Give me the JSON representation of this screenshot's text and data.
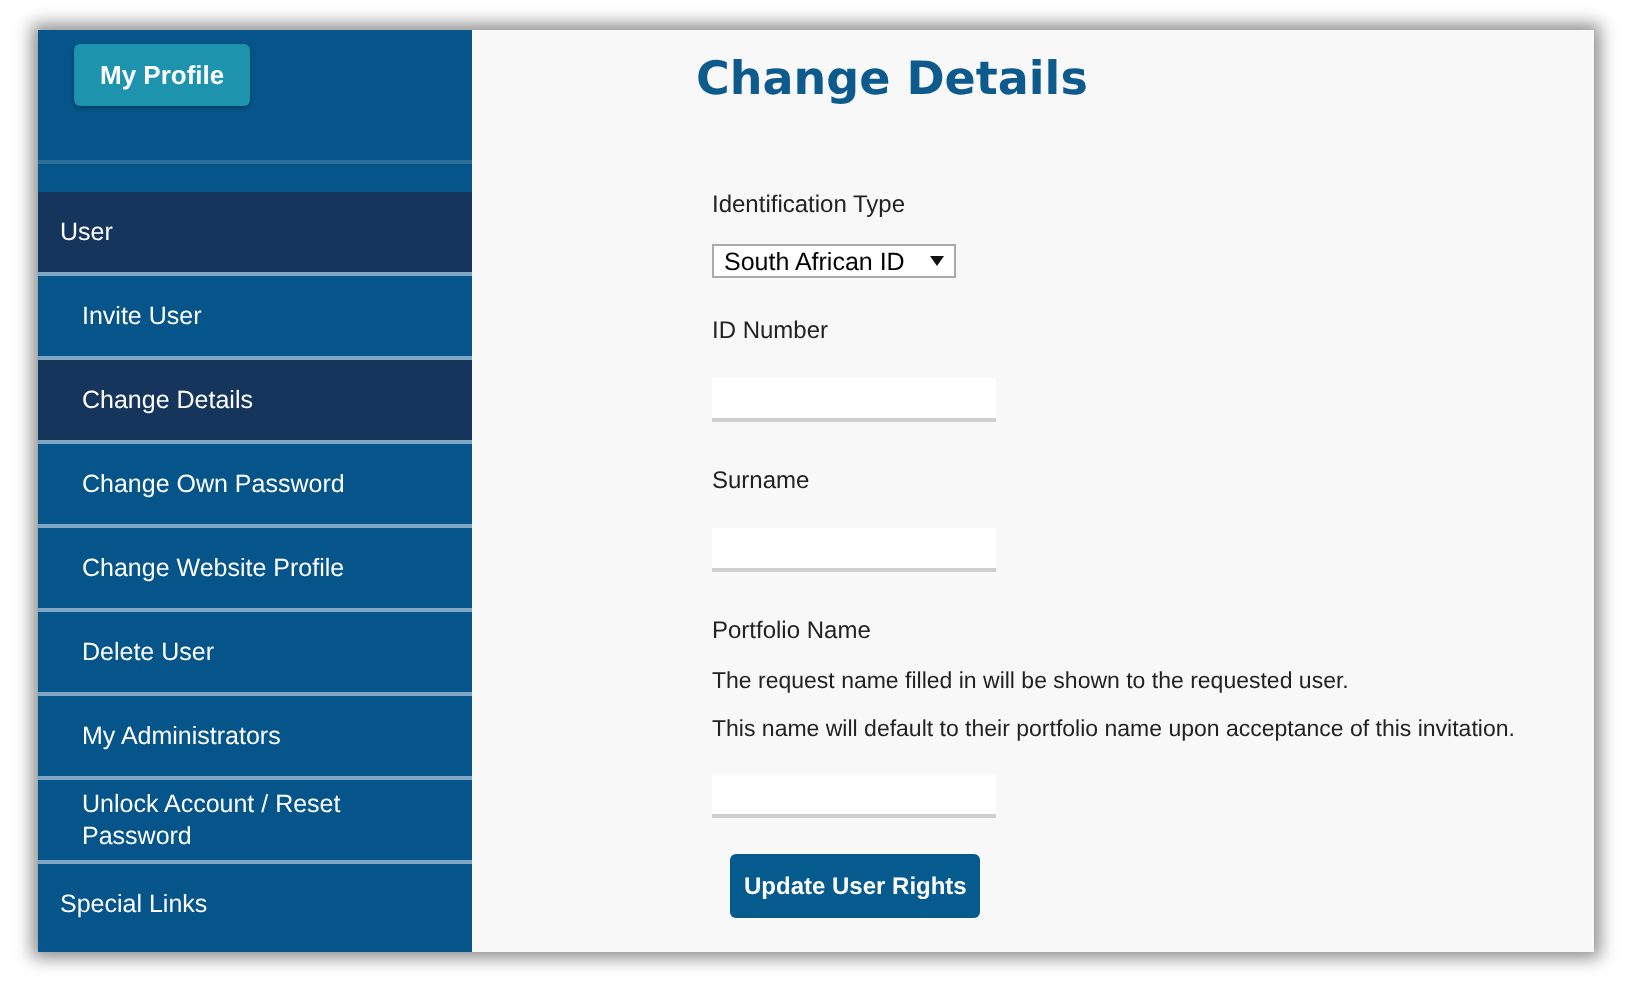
{
  "sidebar": {
    "profile_button": "My Profile",
    "items": [
      {
        "label": "User",
        "kind": "section",
        "selected": true
      },
      {
        "label": "Invite User",
        "kind": "link",
        "selected": false
      },
      {
        "label": "Change Details",
        "kind": "link",
        "selected": true
      },
      {
        "label": "Change Own Password",
        "kind": "link",
        "selected": false
      },
      {
        "label": "Change Website Profile",
        "kind": "link",
        "selected": false
      },
      {
        "label": "Delete User",
        "kind": "link",
        "selected": false
      },
      {
        "label": "My Administrators",
        "kind": "link",
        "selected": false
      },
      {
        "label": "Unlock Account / Reset Password",
        "kind": "link",
        "selected": false
      },
      {
        "label": "Special Links",
        "kind": "section",
        "selected": false
      }
    ]
  },
  "main": {
    "title": "Change Details",
    "fields": [
      {
        "label": "Identification Type",
        "kind": "select",
        "value": "South African ID"
      },
      {
        "label": "ID Number",
        "kind": "text"
      },
      {
        "label": "Surname",
        "kind": "text"
      },
      {
        "label": "Portfolio Name",
        "kind": "text",
        "help": [
          "The request name filled in will be shown to the requested user.",
          "This name will default to their portfolio name upon acceptance of this invitation."
        ]
      }
    ],
    "submit_button": "Update User Rights"
  }
}
